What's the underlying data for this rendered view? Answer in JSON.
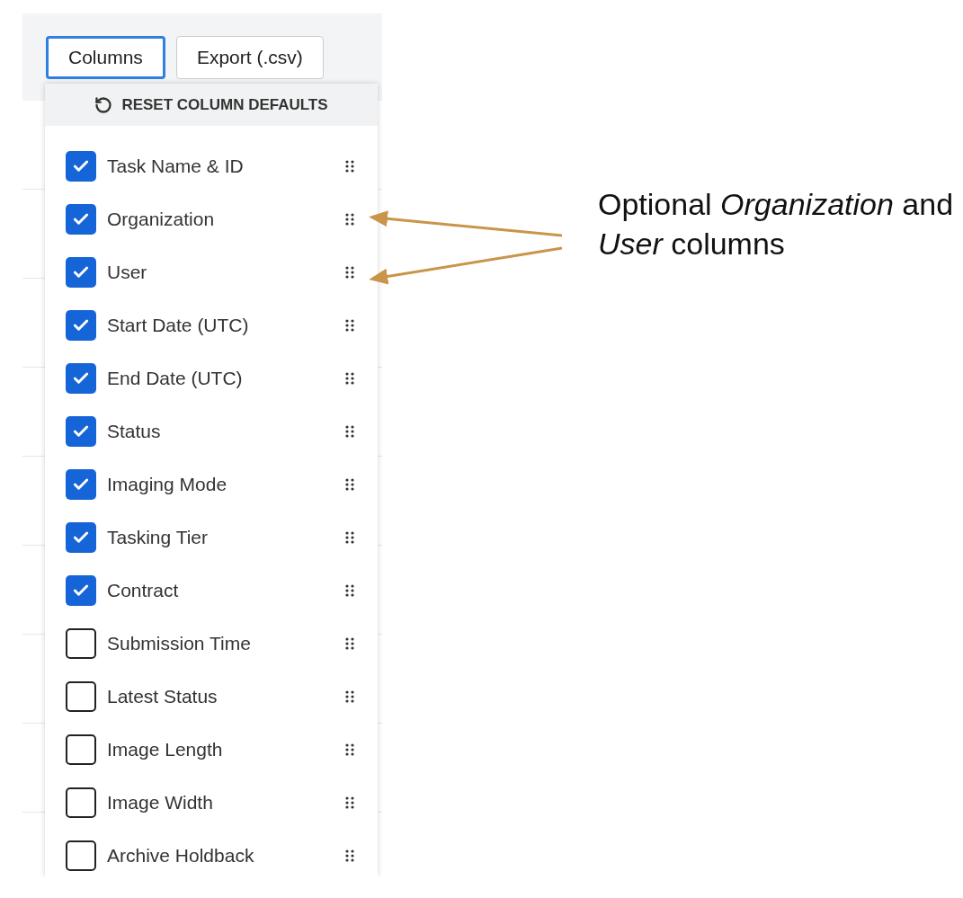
{
  "toolbar": {
    "buttons": [
      {
        "label": "Columns",
        "focused": true
      },
      {
        "label": "Export (.csv)",
        "focused": false
      }
    ]
  },
  "column_menu": {
    "reset_label": "RESET COLUMN DEFAULTS",
    "items": [
      {
        "label": "Task Name & ID",
        "checked": true
      },
      {
        "label": "Organization",
        "checked": true
      },
      {
        "label": "User",
        "checked": true
      },
      {
        "label": "Start Date (UTC)",
        "checked": true
      },
      {
        "label": "End Date (UTC)",
        "checked": true
      },
      {
        "label": "Status",
        "checked": true
      },
      {
        "label": "Imaging Mode",
        "checked": true
      },
      {
        "label": "Tasking Tier",
        "checked": true
      },
      {
        "label": "Contract",
        "checked": true
      },
      {
        "label": "Submission Time",
        "checked": false
      },
      {
        "label": "Latest Status",
        "checked": false
      },
      {
        "label": "Image Length",
        "checked": false
      },
      {
        "label": "Image Width",
        "checked": false
      },
      {
        "label": "Archive Holdback",
        "checked": false
      }
    ]
  },
  "annotation": {
    "text": "Optional *Organization* and *User* columns"
  }
}
